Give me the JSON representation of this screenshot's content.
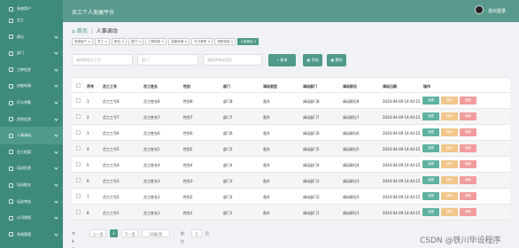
{
  "header": {
    "title": "员工个人发展平台",
    "logout": "退出登录"
  },
  "sidebar": {
    "items": [
      {
        "label": "系统用户",
        "active": false
      },
      {
        "label": "员工",
        "active": false
      },
      {
        "label": "职位",
        "active": false
      },
      {
        "label": "部门",
        "active": false
      },
      {
        "label": "工种信息",
        "active": false
      },
      {
        "label": "技能申请",
        "active": false
      },
      {
        "label": "打卡考勤",
        "active": false
      },
      {
        "label": "资质信息",
        "active": false
      },
      {
        "label": "人事调动",
        "active": true
      },
      {
        "label": "员工档案",
        "active": false
      },
      {
        "label": "培训信息",
        "active": false
      },
      {
        "label": "培训报名",
        "active": false
      },
      {
        "label": "培训考核",
        "active": false
      },
      {
        "label": "公司规划",
        "active": false
      },
      {
        "label": "系统管理",
        "active": false
      }
    ]
  },
  "breadcrumb": {
    "home": "首页",
    "separator": "/",
    "current": "人事调动"
  },
  "tabs": [
    {
      "label": "系统用户"
    },
    {
      "label": "员工"
    },
    {
      "label": "职位"
    },
    {
      "label": "部门"
    },
    {
      "label": "工种信息"
    },
    {
      "label": "技能申请"
    },
    {
      "label": "打卡考勤"
    },
    {
      "label": "资质信息"
    },
    {
      "label": "人事调动",
      "active": true
    }
  ],
  "search": {
    "job_no_placeholder": "请选择员工工号",
    "dept_placeholder": "部门",
    "type_placeholder": "请选择调动类型",
    "query_label": "查询",
    "add_label": "添加",
    "delete_label": "删除"
  },
  "table": {
    "columns": [
      "序号",
      "员工工号",
      "员工姓名",
      "性别",
      "部门",
      "调动类型",
      "调动部门",
      "调动职位",
      "调动日期",
      "操作"
    ],
    "rows": [
      {
        "index": "1",
        "job_no": "员工工号8",
        "name": "员工姓名8",
        "gender": "性别8",
        "dept": "部门8",
        "type": "晋升",
        "new_dept": "调动部门8",
        "new_post": "调动职位8",
        "date": "2024-04-09 14:44:15"
      },
      {
        "index": "2",
        "job_no": "员工工号7",
        "name": "员工姓名7",
        "gender": "性别7",
        "dept": "部门7",
        "type": "晋升",
        "new_dept": "调动部门7",
        "new_post": "调动职位7",
        "date": "2024-04-09 14:44:15"
      },
      {
        "index": "3",
        "job_no": "员工工号6",
        "name": "员工姓名6",
        "gender": "性别6",
        "dept": "部门6",
        "type": "晋升",
        "new_dept": "调动部门6",
        "new_post": "调动职位6",
        "date": "2024-04-09 14:44:15"
      },
      {
        "index": "4",
        "job_no": "员工工号5",
        "name": "员工姓名5",
        "gender": "性别5",
        "dept": "部门5",
        "type": "晋升",
        "new_dept": "调动部门5",
        "new_post": "调动职位5",
        "date": "2024-04-09 14:44:15"
      },
      {
        "index": "5",
        "job_no": "员工工号4",
        "name": "员工姓名4",
        "gender": "性别4",
        "dept": "部门4",
        "type": "晋升",
        "new_dept": "调动部门4",
        "new_post": "调动职位4",
        "date": "2024-04-09 14:44:15"
      },
      {
        "index": "6",
        "job_no": "员工工号3",
        "name": "员工姓名3",
        "gender": "性别3",
        "dept": "部门3",
        "type": "晋升",
        "new_dept": "调动部门3",
        "new_post": "调动职位3",
        "date": "2024-04-09 14:44:15"
      },
      {
        "index": "7",
        "job_no": "员工工号2",
        "name": "员工姓名2",
        "gender": "性别2",
        "dept": "部门2",
        "type": "晋升",
        "new_dept": "调动部门2",
        "new_post": "调动职位2",
        "date": "2024-04-09 14:44:15"
      },
      {
        "index": "8",
        "job_no": "员工工号1",
        "name": "员工姓名1",
        "gender": "性别1",
        "dept": "部门1",
        "type": "晋升",
        "new_dept": "调动部门1",
        "new_post": "调动职位1",
        "date": "2024-04-09 14:44:15"
      }
    ],
    "actions": {
      "view": "查看",
      "edit": "修改",
      "delete": "删除"
    }
  },
  "pagination": {
    "total_label": "共 8 条",
    "prev_label": "上一页",
    "current_page": "1",
    "next_label": "下一页",
    "page_size_label": "10条/页",
    "goto_label": "前往",
    "goto_value": "1",
    "page_suffix": "页"
  },
  "watermark": "CSDN @铁川毕设程序",
  "colors": {
    "sidebar": "#3f8b7b",
    "topbar": "#5a9a8e",
    "accent": "#4f9a8b",
    "edit": "#f0c68b",
    "delete": "#f29c9c"
  }
}
